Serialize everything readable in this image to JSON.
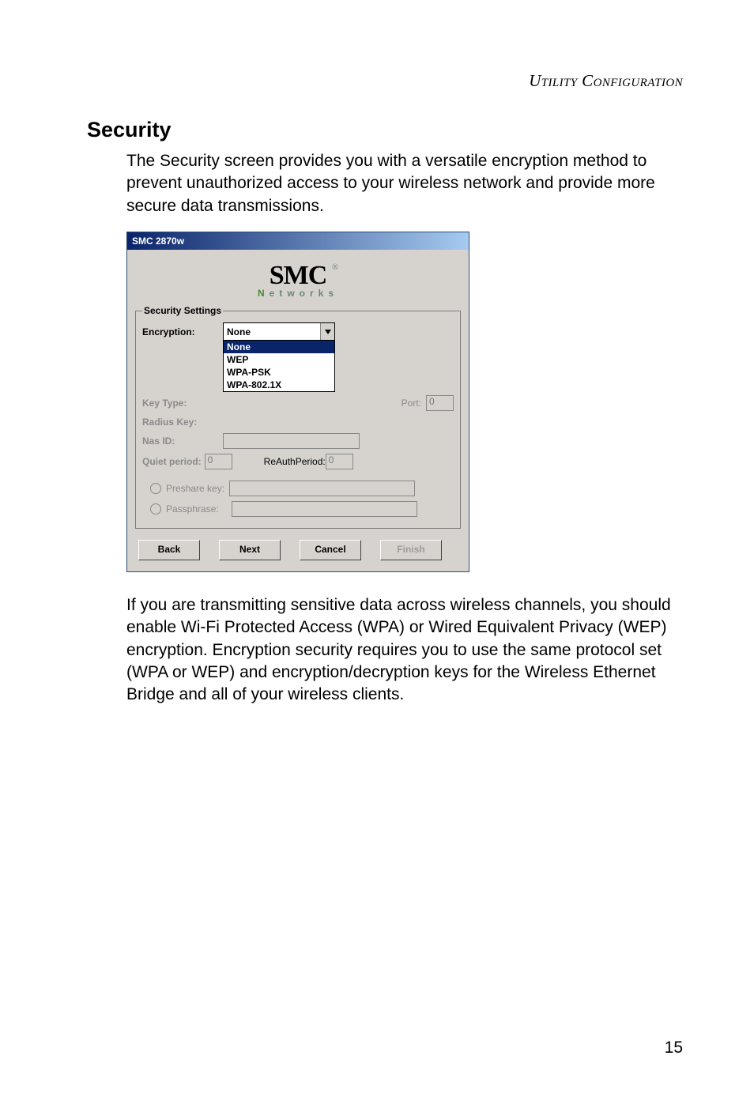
{
  "doc": {
    "header_right": "Utility Configuration",
    "heading": "Security",
    "para1": "The Security screen provides you with a versatile encryption method to prevent unauthorized access to your wireless network and provide more secure data transmissions.",
    "para2": "If you are transmitting sensitive data across wireless channels, you should enable Wi-Fi Protected Access (WPA) or Wired Equivalent Privacy (WEP) encryption. Encryption security requires you to use the same protocol set (WPA or WEP) and encryption/decryption keys for the Wireless Ethernet Bridge and all of your wireless clients.",
    "page_number": "15"
  },
  "wizard": {
    "titlebar": "SMC 2870w",
    "logo_main": "SMC",
    "logo_reg": "®",
    "logo_sub_first": "N",
    "logo_sub_rest": "etworks",
    "legend": "Security Settings",
    "labels": {
      "encryption": "Encryption:",
      "key_type": "Key Type:",
      "radius_key": "Radius Key:",
      "nas_id": "Nas ID:",
      "quiet_period": "Quiet period:",
      "reauth_period": "ReAuthPeriod:",
      "port": "Port:",
      "preshare": "Preshare key:",
      "passphrase": "Passphrase:"
    },
    "encryption_selected": "None",
    "encryption_options": {
      "o0": "None",
      "o1": "WEP",
      "o2": "WPA-PSK",
      "o3": "WPA-802.1X"
    },
    "values": {
      "port": "0",
      "quiet_period": "0",
      "reauth_period": "0",
      "radius_key": "",
      "nas_id": "",
      "preshare": "",
      "passphrase": ""
    },
    "buttons": {
      "back": "Back",
      "next": "Next",
      "cancel": "Cancel",
      "finish": "Finish"
    }
  }
}
